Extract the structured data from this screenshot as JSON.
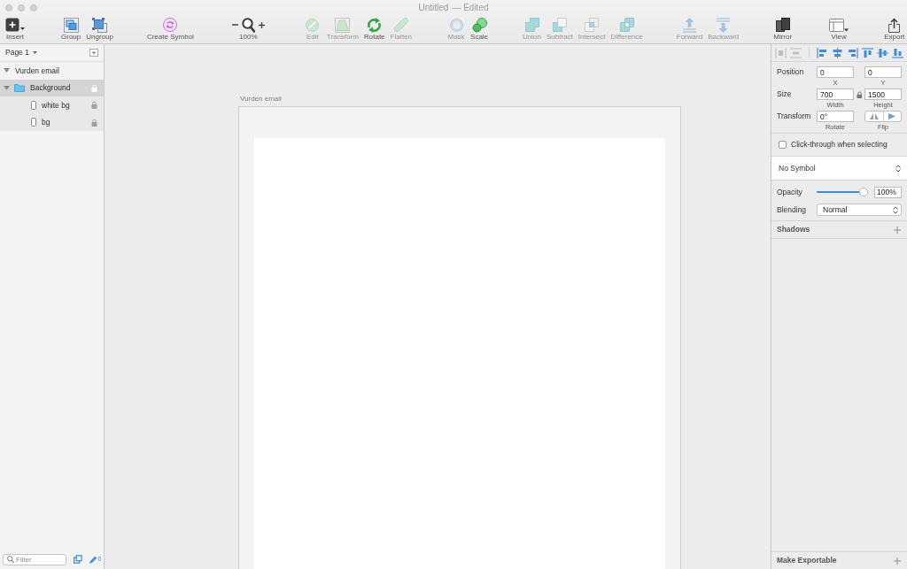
{
  "window": {
    "title": "Untitled",
    "status": "— Edited"
  },
  "toolbar": [
    {
      "items": [
        {
          "kind": "insert",
          "label": "Insert",
          "disabled": false
        }
      ]
    },
    {
      "items": [
        {
          "kind": "group",
          "label": "Group",
          "disabled": false
        },
        {
          "kind": "ungroup",
          "label": "Ungroup",
          "disabled": false
        }
      ]
    },
    {
      "items": [
        {
          "kind": "symbol",
          "label": "Create Symbol",
          "disabled": false
        }
      ]
    },
    {
      "items": [
        {
          "kind": "zoom",
          "label": "100%",
          "disabled": false
        }
      ]
    },
    {
      "items": [
        {
          "kind": "edit",
          "label": "Edit",
          "disabled": true
        },
        {
          "kind": "transform",
          "label": "Transform",
          "disabled": true
        },
        {
          "kind": "rotate",
          "label": "Rotate",
          "disabled": false
        },
        {
          "kind": "flatten",
          "label": "Flatten",
          "disabled": true
        }
      ]
    },
    {
      "items": [
        {
          "kind": "mask",
          "label": "Mask",
          "disabled": true
        },
        {
          "kind": "scale",
          "label": "Scale",
          "disabled": false
        }
      ]
    },
    {
      "items": [
        {
          "kind": "union",
          "label": "Union",
          "disabled": true
        },
        {
          "kind": "subtract",
          "label": "Subtract",
          "disabled": true
        },
        {
          "kind": "intersect",
          "label": "Intersect",
          "disabled": true
        },
        {
          "kind": "difference",
          "label": "Difference",
          "disabled": true
        }
      ]
    },
    {
      "items": [
        {
          "kind": "forward",
          "label": "Forward",
          "disabled": true
        },
        {
          "kind": "backward",
          "label": "Backward",
          "disabled": true
        }
      ]
    },
    {
      "items": [
        {
          "kind": "mirror",
          "label": "Mirror",
          "disabled": false
        }
      ]
    },
    {
      "items": [
        {
          "kind": "view",
          "label": "View",
          "disabled": false
        }
      ]
    },
    {
      "items": [
        {
          "kind": "export",
          "label": "Export",
          "disabled": false
        }
      ]
    }
  ],
  "sidebar": {
    "page": "Page 1",
    "layers": [
      {
        "name": "Vurden email",
        "expanded": true,
        "selected": false,
        "locked": false,
        "children": [
          {
            "name": "Background",
            "kind": "group",
            "expanded": true,
            "selected": true,
            "locked": true,
            "children": [
              {
                "name": "white bg",
                "kind": "shape",
                "selected": false,
                "locked": true
              },
              {
                "name": "bg",
                "kind": "shape",
                "selected": false,
                "locked": true
              }
            ]
          }
        ]
      }
    ],
    "filter": {
      "placeholder": "Filter"
    },
    "footer_count": "0"
  },
  "canvas": {
    "artboard": {
      "name": "Vurden email"
    }
  },
  "inspector": {
    "align_tools": [
      {
        "kind": "hdist",
        "disabled": true
      },
      {
        "kind": "vdist",
        "disabled": true
      },
      {
        "kind": "left",
        "disabled": false
      },
      {
        "kind": "hcenter",
        "disabled": false
      },
      {
        "kind": "right",
        "disabled": false
      },
      {
        "kind": "top",
        "disabled": false
      },
      {
        "kind": "vmiddle",
        "disabled": false
      },
      {
        "kind": "bottom",
        "disabled": false
      }
    ],
    "position": {
      "label": "Position",
      "fields": [
        {
          "value": "0",
          "caption": "X"
        },
        {
          "value": "0",
          "caption": "Y"
        }
      ]
    },
    "size": {
      "label": "Size",
      "fields": [
        {
          "value": "700",
          "caption": "Width"
        },
        {
          "value": "1500",
          "caption": "Height"
        }
      ]
    },
    "transform": {
      "label": "Transform",
      "rotation": {
        "value": "0°",
        "caption": "Rotate"
      },
      "flip": {
        "caption": "Flip"
      }
    },
    "click_through": {
      "label": "Click-through when selecting",
      "checked": false
    },
    "symbol": {
      "value": "No Symbol"
    },
    "opacity": {
      "label": "Opacity",
      "level": 1,
      "value": "100%"
    },
    "blending": {
      "label": "Blending",
      "value": "Normal"
    },
    "shadows": {
      "label": "Shadows"
    },
    "export": {
      "label": "Make Exportable"
    }
  }
}
